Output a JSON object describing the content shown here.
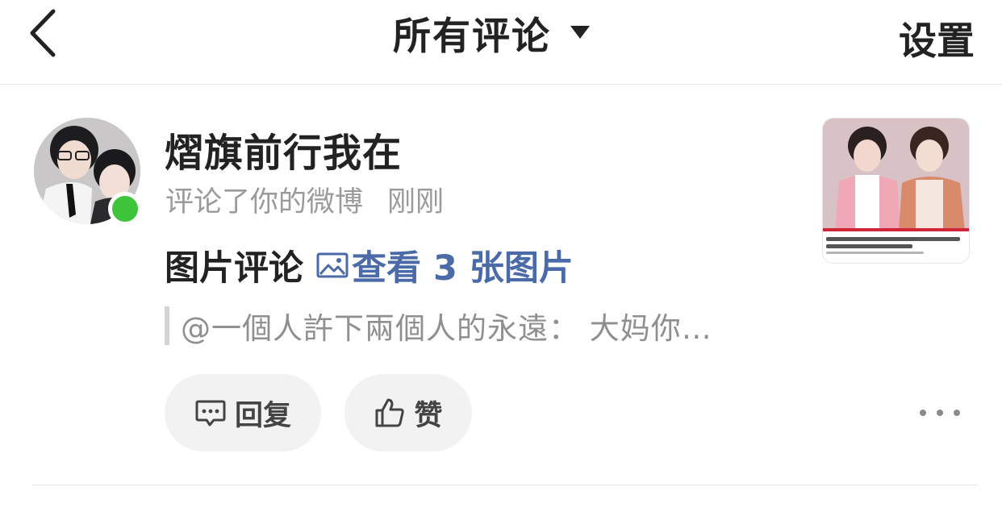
{
  "nav": {
    "title": "所有评论",
    "settings_label": "设置",
    "back_icon": "chevron-left-icon",
    "caret_icon": "caret-down-icon"
  },
  "comment": {
    "username": "熠旗前行我在",
    "action_text": "评论了你的微博",
    "time": "刚刚",
    "online": true,
    "online_color": "#3fc53b",
    "body_text": "图片评论",
    "view_images_label": "查看 3 张图片",
    "quoted_text": "@一個人許下兩個人的永遠： 大妈你…",
    "link_color": "#4a6aa8"
  },
  "actions": {
    "reply_label": "回复",
    "like_label": "赞",
    "reply_icon": "comment-bubble-icon",
    "like_icon": "thumbs-up-icon",
    "more_icon": "more-dots-icon"
  },
  "thumbnail": {
    "icon": "video-thumbnail"
  }
}
